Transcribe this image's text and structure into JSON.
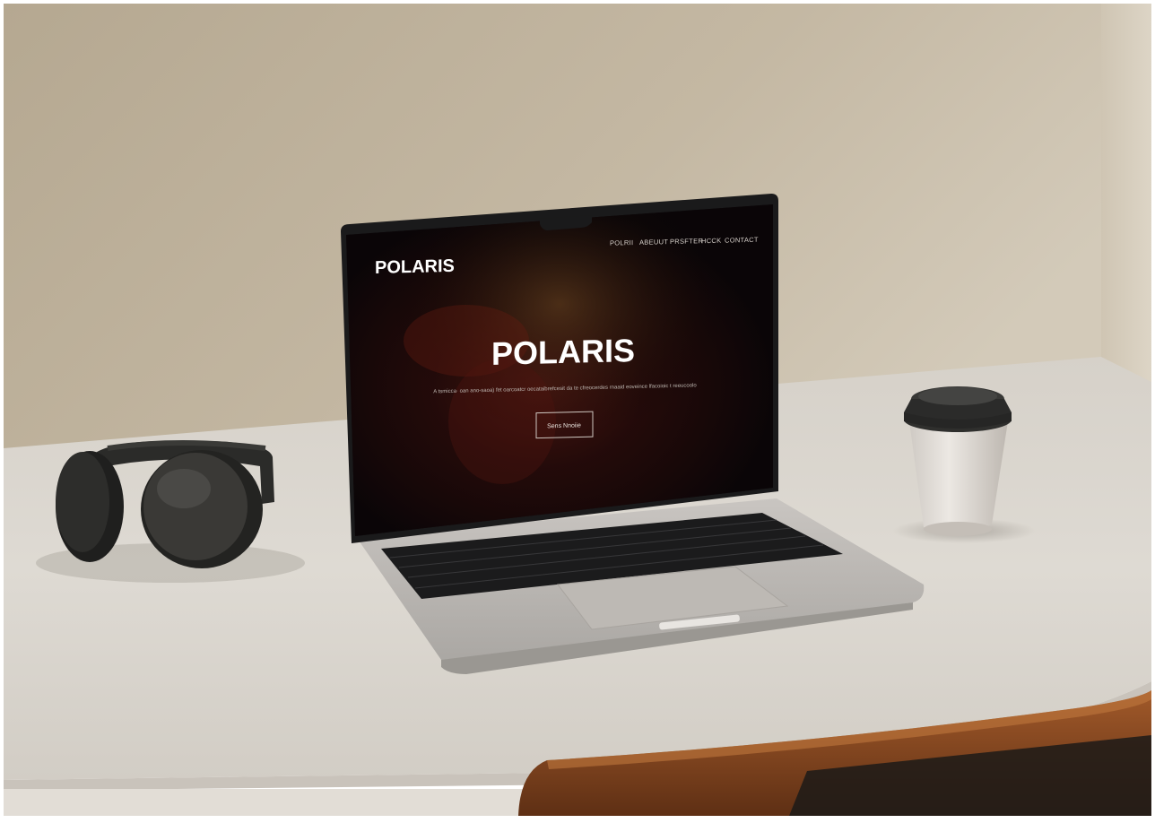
{
  "scene": "Laptop on a desk displaying a dark website",
  "website": {
    "logo": "POLARIS",
    "nav": [
      "POLRII",
      "ABEUUT",
      "PRSFTER",
      "HCCK",
      "CONTACT"
    ],
    "hero_title": "POLARIS",
    "tagline": "A tsmicca·  oan ano-saoa) fet oarcoatcr oecataibrefcesit da te  cfreocerdes rnaaid eoveince lfacoioic  t reeucoolo",
    "cta_label": "Sens Nnoiie"
  },
  "colors": {
    "wall": "#b7aa95",
    "desk": "#ddd8d1",
    "screen_bg": "#0d0709",
    "nebula": "#5a1a12",
    "chair_wood": "#8a4a22",
    "cup_lid": "#2f2f2d"
  },
  "icons": [
    "headphones-icon",
    "coffee-cup-icon"
  ]
}
